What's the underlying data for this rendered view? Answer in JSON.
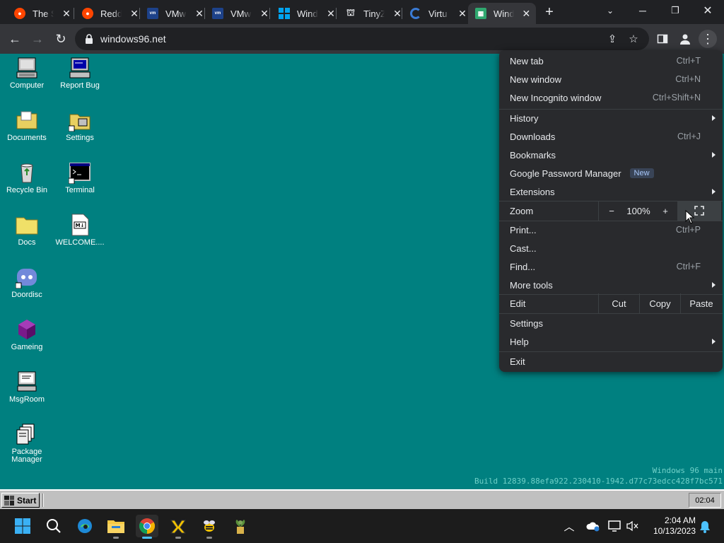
{
  "browser": {
    "tabs": [
      {
        "title": "The S",
        "icon": "reddit-icon",
        "color": "#ff4500"
      },
      {
        "title": "Redd",
        "icon": "reddit-icon",
        "color": "#ff4500"
      },
      {
        "title": "VMw",
        "icon": "vmware-icon",
        "color": "#1d428a"
      },
      {
        "title": "VMw",
        "icon": "vmware-icon",
        "color": "#1d428a"
      },
      {
        "title": "Wind",
        "icon": "windows-icon",
        "color": "#00a4ef"
      },
      {
        "title": "TinyZ",
        "icon": "museum-icon",
        "color": "#e8eaed"
      },
      {
        "title": "Virtu",
        "icon": "virtual-icon",
        "color": "#3a7bd5"
      },
      {
        "title": "Wind",
        "icon": "win96-icon",
        "color": "#2fa86f"
      }
    ],
    "url": "windows96.net"
  },
  "desktop": {
    "icons": [
      {
        "label": "Computer",
        "icon": "computer-icon"
      },
      {
        "label": "Report Bug",
        "icon": "report-bug-icon"
      },
      {
        "label": "Documents",
        "icon": "documents-icon"
      },
      {
        "label": "Settings",
        "icon": "settings-icon"
      },
      {
        "label": "Recycle Bin",
        "icon": "recycle-bin-icon"
      },
      {
        "label": "Terminal",
        "icon": "terminal-icon"
      },
      {
        "label": "Docs",
        "icon": "folder-icon"
      },
      {
        "label": "WELCOME....",
        "icon": "markdown-file-icon"
      },
      {
        "label": "Doordisc",
        "icon": "doordisc-icon"
      },
      {
        "label": "Gameing",
        "icon": "gameing-icon"
      },
      {
        "label": "MsgRoom",
        "icon": "msgroom-icon"
      },
      {
        "label": "Package Manager",
        "icon": "package-manager-icon"
      }
    ],
    "build_line1": "Windows 96 main",
    "build_line2": "Build 12839.88efa922.230410-1942.d77c73edcc428f7bc571"
  },
  "win96_taskbar": {
    "start_label": "Start",
    "clock": "02:04"
  },
  "menu": {
    "new_tab": {
      "label": "New tab",
      "shortcut": "Ctrl+T"
    },
    "new_window": {
      "label": "New window",
      "shortcut": "Ctrl+N"
    },
    "incognito": {
      "label": "New Incognito window",
      "shortcut": "Ctrl+Shift+N"
    },
    "history": {
      "label": "History"
    },
    "downloads": {
      "label": "Downloads",
      "shortcut": "Ctrl+J"
    },
    "bookmarks": {
      "label": "Bookmarks"
    },
    "password_manager": {
      "label": "Google Password Manager",
      "badge": "New"
    },
    "extensions": {
      "label": "Extensions"
    },
    "zoom": {
      "label": "Zoom",
      "minus": "−",
      "value": "100%",
      "plus": "+"
    },
    "print": {
      "label": "Print...",
      "shortcut": "Ctrl+P"
    },
    "cast": {
      "label": "Cast..."
    },
    "find": {
      "label": "Find...",
      "shortcut": "Ctrl+F"
    },
    "more_tools": {
      "label": "More tools"
    },
    "edit": {
      "label": "Edit",
      "cut": "Cut",
      "copy": "Copy",
      "paste": "Paste"
    },
    "settings": {
      "label": "Settings"
    },
    "help": {
      "label": "Help"
    },
    "exit": {
      "label": "Exit"
    }
  },
  "windows_taskbar": {
    "time": "2:04 AM",
    "date": "10/13/2023"
  }
}
